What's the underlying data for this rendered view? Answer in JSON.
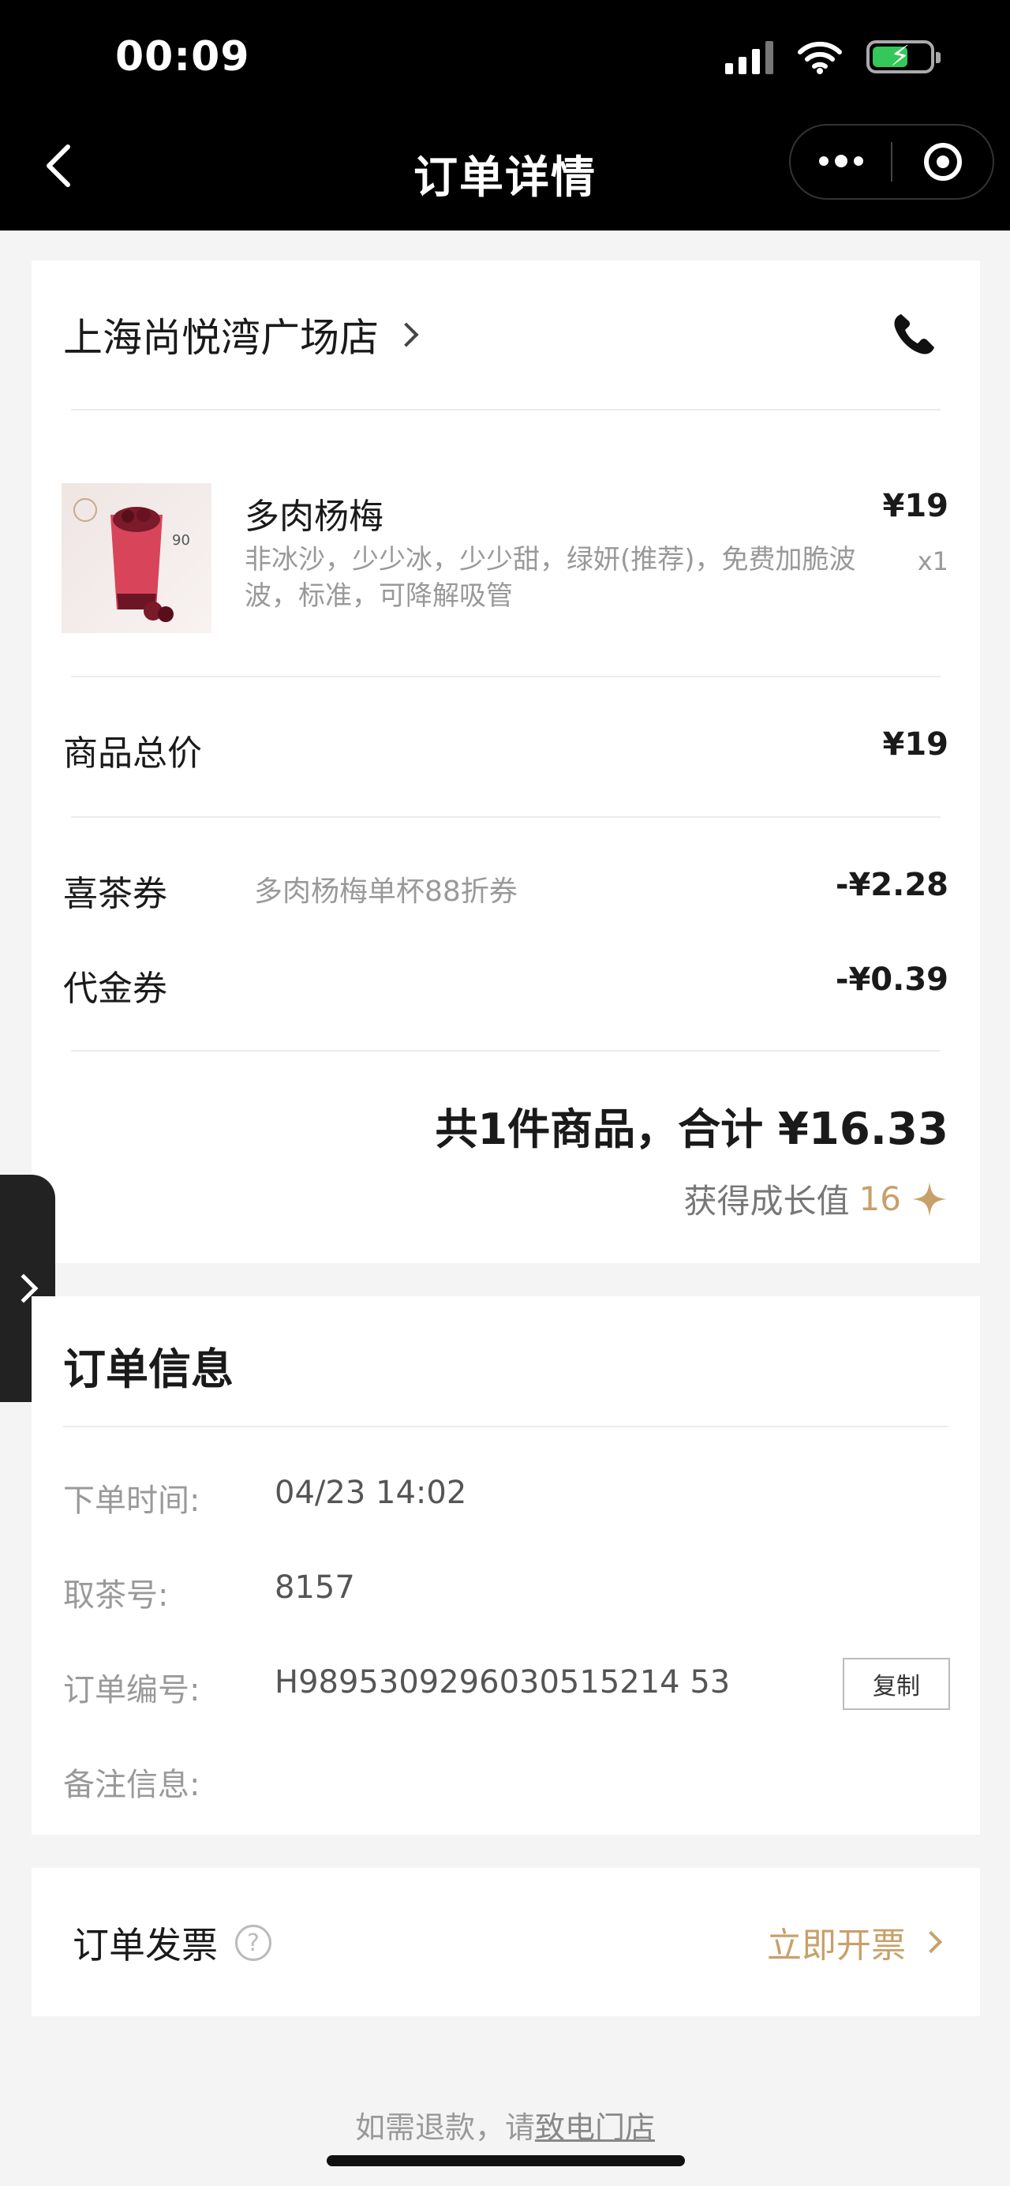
{
  "status_bar": {
    "time": "00:09"
  },
  "nav": {
    "title": "订单详情"
  },
  "store": {
    "name": "上海尚悦湾广场店"
  },
  "product": {
    "name": "多肉杨梅",
    "options": "非冰沙，少少冰，少少甜，绿妍(推荐)，免费加脆波波，标准，可降解吸管",
    "price": "¥19",
    "quantity": "x1",
    "image_text": "90"
  },
  "summary": {
    "subtotal_label": "商品总价",
    "subtotal_value": "¥19",
    "coupon_label": "喜茶券",
    "coupon_desc": "多肉杨梅单杯88折券",
    "coupon_value": "-¥2.28",
    "voucher_label": "代金券",
    "voucher_value": "-¥0.39",
    "total_text": "共1件商品，合计",
    "total_amount": "¥16.33",
    "growth_label": "获得成长值",
    "growth_value": "16"
  },
  "order_info": {
    "title": "订单信息",
    "time_label": "下单时间:",
    "time_value": "04/23 14:02",
    "pickup_label": "取茶号:",
    "pickup_value": "8157",
    "order_no_label": "订单编号:",
    "order_no_value": "H9895309296030515214 53",
    "copy_label": "复制",
    "remark_label": "备注信息:"
  },
  "invoice": {
    "title": "订单发票",
    "help": "?",
    "action": "立即开票"
  },
  "footer": {
    "note_prefix": "如需退款，请",
    "note_link": "致电门店"
  },
  "colors": {
    "accent": "#c8a06a",
    "topbar": "#000000"
  }
}
